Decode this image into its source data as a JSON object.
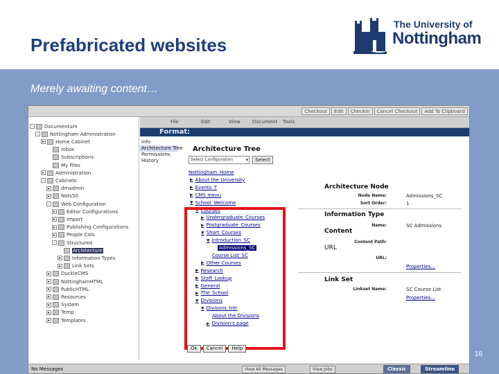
{
  "slide": {
    "title": "Prefabricated websites",
    "subtitle": "Merely awaiting content…",
    "page_number": "16",
    "logo_line1": "The University of",
    "logo_line2": "Nottingham"
  },
  "app": {
    "top_buttons": [
      "Checkout",
      "Edit",
      "Checkin",
      "Cancel Checkout",
      "Add To Clipboard"
    ],
    "menu": [
      "File",
      "Edit",
      "View",
      "Document",
      "Tools"
    ],
    "format_label": "Format:",
    "side_tabs": [
      "Info",
      "Architecture Tree",
      "Permissions",
      "History"
    ],
    "panel_title": "Architecture Tree",
    "config_select": "Select Configuration",
    "select_button": "Select",
    "left_tree": [
      {
        "label": "Documentum",
        "twisty": "–"
      },
      {
        "label": "Nottingham Administration",
        "twisty": "–"
      },
      {
        "label": "Home Cabinet",
        "twisty": "▸"
      },
      {
        "label": "Inbox",
        "twisty": ""
      },
      {
        "label": "Subscriptions",
        "twisty": ""
      },
      {
        "label": "My Files",
        "twisty": ""
      },
      {
        "label": "Administration",
        "twisty": "▸"
      },
      {
        "label": "Cabinets",
        "twisty": "–"
      },
      {
        "label": "dmadmin",
        "twisty": "▸"
      },
      {
        "label": "Nots50",
        "twisty": "▸"
      },
      {
        "label": "Web Configuration",
        "twisty": "–"
      },
      {
        "label": "Editor Configurations",
        "twisty": "▸"
      },
      {
        "label": "Import",
        "twisty": "▸"
      },
      {
        "label": "Publishing Configurations",
        "twisty": "▸"
      },
      {
        "label": "People Cols",
        "twisty": "▸"
      },
      {
        "label": "Structured",
        "twisty": "–"
      },
      {
        "label": "Architecture",
        "twisty": "",
        "selected": true
      },
      {
        "label": "Information Types",
        "twisty": "▸"
      },
      {
        "label": "Link Sets",
        "twisty": "▸"
      },
      {
        "label": "DuckleCMS",
        "twisty": "▸"
      },
      {
        "label": "NottinghamHTML",
        "twisty": "▸"
      },
      {
        "label": "PublicHTML",
        "twisty": "▸"
      },
      {
        "label": "Resources",
        "twisty": "▸"
      },
      {
        "label": "System",
        "twisty": "▸"
      },
      {
        "label": "Temp",
        "twisty": "▸"
      },
      {
        "label": "Templates",
        "twisty": "▸"
      }
    ],
    "arch_tree": [
      {
        "label": "Nottingham_Home",
        "arrow": ""
      },
      {
        "label": "About the University",
        "arrow": "▶"
      },
      {
        "label": "Events_T",
        "arrow": "▶"
      },
      {
        "label": "CMS menu",
        "arrow": "▶"
      },
      {
        "label": "School_Welcome",
        "arrow": "▼"
      },
      {
        "label": "Courses",
        "arrow": "▼"
      },
      {
        "label": "Undergraduate_Courses",
        "arrow": "▶"
      },
      {
        "label": "Postgraduate_Courses",
        "arrow": "▶"
      },
      {
        "label": "Short_Courses",
        "arrow": "▼"
      },
      {
        "label": "Introduction_SC",
        "arrow": "▼"
      },
      {
        "label": "Admissions_SC",
        "arrow": "",
        "selected": true
      },
      {
        "label": "Course List_SC",
        "arrow": ""
      },
      {
        "label": "Other Courses",
        "arrow": "▶"
      },
      {
        "label": "Research",
        "arrow": "▶"
      },
      {
        "label": "Staff_Lookup",
        "arrow": "▶"
      },
      {
        "label": "General",
        "arrow": "▶"
      },
      {
        "label": "The_School",
        "arrow": "▶"
      },
      {
        "label": "Divisions",
        "arrow": "▼"
      },
      {
        "label": "Divisons_Intr",
        "arrow": "▼"
      },
      {
        "label": "About the Divisions",
        "arrow": ""
      },
      {
        "label": "Division's page",
        "arrow": "▶"
      }
    ],
    "node": {
      "heading": "Architecture Node",
      "name_label": "Node Name:",
      "name_value": "Admissions_SC",
      "sort_label": "Sort Order:",
      "sort_value": "1"
    },
    "info_type": {
      "heading": "Information Type",
      "name_label": "Name:",
      "name_value": "SC Admissions"
    },
    "content": {
      "heading": "Content",
      "path_label": "Content Path:",
      "url_heading": "URL",
      "url_label": "URL:",
      "properties": "Properties..."
    },
    "link_set": {
      "heading": "Link Set",
      "name_label": "Linkset Name:",
      "name_value": "SC Course List",
      "properties": "Properties..."
    },
    "bottom_buttons": [
      "Ok",
      "Cancel",
      "Help"
    ],
    "status": {
      "text": "No Messages",
      "view_messages": "View All Messages",
      "view_jobs": "View Jobs",
      "tab_classic": "Classic",
      "tab_streamline": "Streamline"
    }
  },
  "colors": {
    "title": "#1f3f78",
    "band": "#819cc8",
    "highlight_box": "#e3141b",
    "format_bar": "#1a3d6d"
  }
}
